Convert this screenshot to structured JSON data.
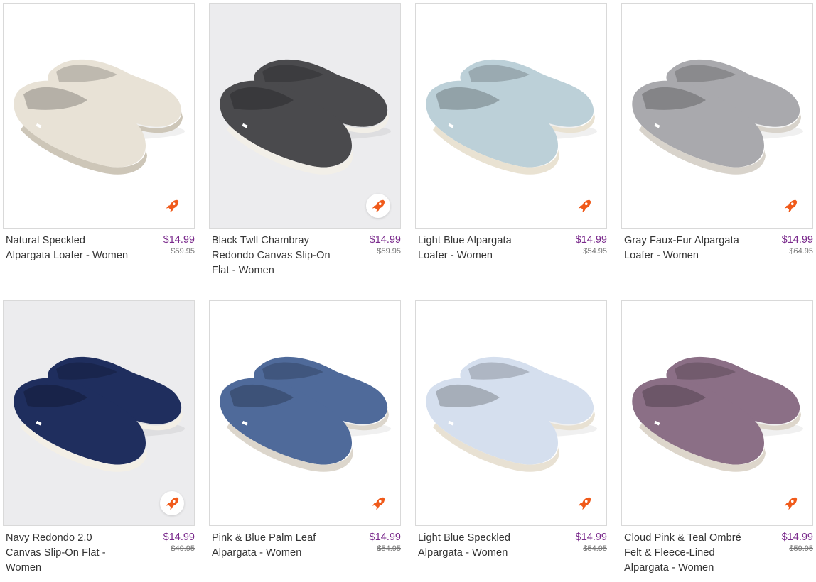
{
  "products": [
    {
      "name": "Natural Speckled Alpargata Loafer - Women",
      "sale_price": "$14.99",
      "original_price": "$59.95",
      "badge_icon": "rocket-icon",
      "shoe_color": "#e8e2d6",
      "sole_color": "#cdc6b8",
      "bg": "white"
    },
    {
      "name": "Black Twll Chambray Redondo Canvas Slip-On Flat - Women",
      "sale_price": "$14.99",
      "original_price": "$59.95",
      "badge_icon": "rocket-icon",
      "shoe_color": "#4a4a4d",
      "sole_color": "#f2efe8",
      "bg": "gray"
    },
    {
      "name": "Light Blue Alpargata Loafer - Women",
      "sale_price": "$14.99",
      "original_price": "$54.95",
      "badge_icon": "rocket-icon",
      "shoe_color": "#bcd0d8",
      "sole_color": "#e9e2d2",
      "bg": "white"
    },
    {
      "name": "Gray Faux-Fur Alpargata Loafer - Women",
      "sale_price": "$14.99",
      "original_price": "$64.95",
      "badge_icon": "rocket-icon",
      "shoe_color": "#a9a9ad",
      "sole_color": "#d8d3cb",
      "bg": "white"
    },
    {
      "name": "Navy Redondo 2.0 Canvas Slip-On Flat - Women",
      "sale_price": "$14.99",
      "original_price": "$49.95",
      "badge_icon": "rocket-icon",
      "shoe_color": "#1f2e5e",
      "sole_color": "#f3efe6",
      "bg": "gray"
    },
    {
      "name": "Pink & Blue Palm Leaf Alpargata - Women",
      "sale_price": "$14.99",
      "original_price": "$54.95",
      "badge_icon": "rocket-icon",
      "shoe_color": "#4f6a9a",
      "sole_color": "#dcd6cc",
      "bg": "white"
    },
    {
      "name": "Light Blue Speckled Alpargata - Women",
      "sale_price": "$14.99",
      "original_price": "$54.95",
      "badge_icon": "rocket-icon",
      "shoe_color": "#d5dfee",
      "sole_color": "#e8e1d3",
      "bg": "white"
    },
    {
      "name": "Cloud Pink & Teal Ombré Felt & Fleece-Lined Alpargata - Women",
      "sale_price": "$14.99",
      "original_price": "$59.95",
      "badge_icon": "rocket-icon",
      "shoe_color": "#8b6f86",
      "sole_color": "#ddd6cb",
      "bg": "white"
    }
  ],
  "colors": {
    "sale_price": "#7a2a8c",
    "badge": "#f05a1a"
  }
}
